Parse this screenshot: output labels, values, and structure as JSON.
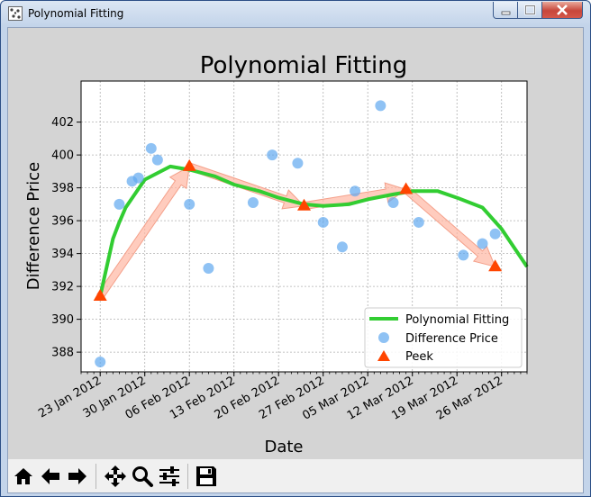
{
  "window": {
    "title": "Polynomial Fitting",
    "app_icon": "matplotlib-icon"
  },
  "chart_data": {
    "type": "line",
    "title": "Polynomial Fitting",
    "xlabel": "Date",
    "ylabel": "Difference Price",
    "grid": true,
    "legend_position": "lower-right",
    "ylim": [
      386.8,
      404.5
    ],
    "xlim": [
      "2012-01-20",
      "2012-03-30"
    ],
    "x_ticks": [
      "23 Jan 2012",
      "30 Jan 2012",
      "06 Feb 2012",
      "13 Feb 2012",
      "20 Feb 2012",
      "27 Feb 2012",
      "05 Mar 2012",
      "12 Mar 2012",
      "19 Mar 2012",
      "26 Mar 2012"
    ],
    "x_tick_dates": [
      "2012-01-23",
      "2012-01-30",
      "2012-02-06",
      "2012-02-13",
      "2012-02-20",
      "2012-02-27",
      "2012-03-05",
      "2012-03-12",
      "2012-03-19",
      "2012-03-26"
    ],
    "y_ticks": [
      388,
      390,
      392,
      394,
      396,
      398,
      400,
      402
    ],
    "series": [
      {
        "name": "Polynomial Fitting",
        "kind": "line",
        "color": "#32cd32",
        "points": [
          [
            "2012-01-23",
            391.4
          ],
          [
            "2012-01-25",
            394.9
          ],
          [
            "2012-01-26",
            395.9
          ],
          [
            "2012-01-27",
            396.8
          ],
          [
            "2012-01-30",
            398.5
          ],
          [
            "2012-02-03",
            399.3
          ],
          [
            "2012-02-06",
            399.1
          ],
          [
            "2012-02-10",
            398.7
          ],
          [
            "2012-02-13",
            398.2
          ],
          [
            "2012-02-17",
            397.8
          ],
          [
            "2012-02-20",
            397.4
          ],
          [
            "2012-02-24",
            397.0
          ],
          [
            "2012-02-27",
            396.9
          ],
          [
            "2012-03-02",
            397.0
          ],
          [
            "2012-03-05",
            397.3
          ],
          [
            "2012-03-09",
            397.6
          ],
          [
            "2012-03-12",
            397.8
          ],
          [
            "2012-03-16",
            397.8
          ],
          [
            "2012-03-19",
            397.4
          ],
          [
            "2012-03-23",
            396.8
          ],
          [
            "2012-03-26",
            395.5
          ],
          [
            "2012-03-30",
            393.2
          ]
        ]
      },
      {
        "name": "Difference Price",
        "kind": "scatter",
        "color": "#5fa8ef",
        "points": [
          [
            "2012-01-23",
            387.4
          ],
          [
            "2012-01-26",
            397.0
          ],
          [
            "2012-01-28",
            398.4
          ],
          [
            "2012-01-29",
            398.6
          ],
          [
            "2012-01-31",
            400.4
          ],
          [
            "2012-02-01",
            399.7
          ],
          [
            "2012-02-06",
            397.0
          ],
          [
            "2012-02-09",
            393.1
          ],
          [
            "2012-02-16",
            397.1
          ],
          [
            "2012-02-19",
            400.0
          ],
          [
            "2012-02-23",
            399.5
          ],
          [
            "2012-02-27",
            395.9
          ],
          [
            "2012-03-01",
            394.4
          ],
          [
            "2012-03-03",
            397.8
          ],
          [
            "2012-03-07",
            403.0
          ],
          [
            "2012-03-09",
            397.1
          ],
          [
            "2012-03-13",
            395.9
          ],
          [
            "2012-03-20",
            393.9
          ],
          [
            "2012-03-23",
            394.6
          ],
          [
            "2012-03-25",
            395.2
          ]
        ]
      },
      {
        "name": "Peek",
        "kind": "marker",
        "color": "#ff4500",
        "points": [
          [
            "2012-01-23",
            391.4
          ],
          [
            "2012-02-06",
            399.3
          ],
          [
            "2012-02-24",
            396.9
          ],
          [
            "2012-03-11",
            397.9
          ],
          [
            "2012-03-25",
            393.2
          ]
        ]
      }
    ],
    "arrows": [
      {
        "from": [
          "2012-01-23",
          391.4
        ],
        "to": [
          "2012-02-06",
          399.3
        ]
      },
      {
        "from": [
          "2012-02-06",
          399.3
        ],
        "to": [
          "2012-02-24",
          396.9
        ]
      },
      {
        "from": [
          "2012-02-24",
          396.9
        ],
        "to": [
          "2012-03-11",
          397.9
        ]
      },
      {
        "from": [
          "2012-03-11",
          397.9
        ],
        "to": [
          "2012-03-25",
          393.2
        ]
      }
    ]
  },
  "toolbar": {
    "buttons": [
      {
        "name": "home-button",
        "icon": "home-icon"
      },
      {
        "name": "back-button",
        "icon": "arrow-left-icon"
      },
      {
        "name": "forward-button",
        "icon": "arrow-right-icon"
      },
      {
        "name": "pan-button",
        "icon": "move-icon"
      },
      {
        "name": "zoom-button",
        "icon": "magnifier-icon"
      },
      {
        "name": "configure-subplots-button",
        "icon": "sliders-icon"
      },
      {
        "name": "save-button",
        "icon": "floppy-disk-icon"
      }
    ]
  }
}
